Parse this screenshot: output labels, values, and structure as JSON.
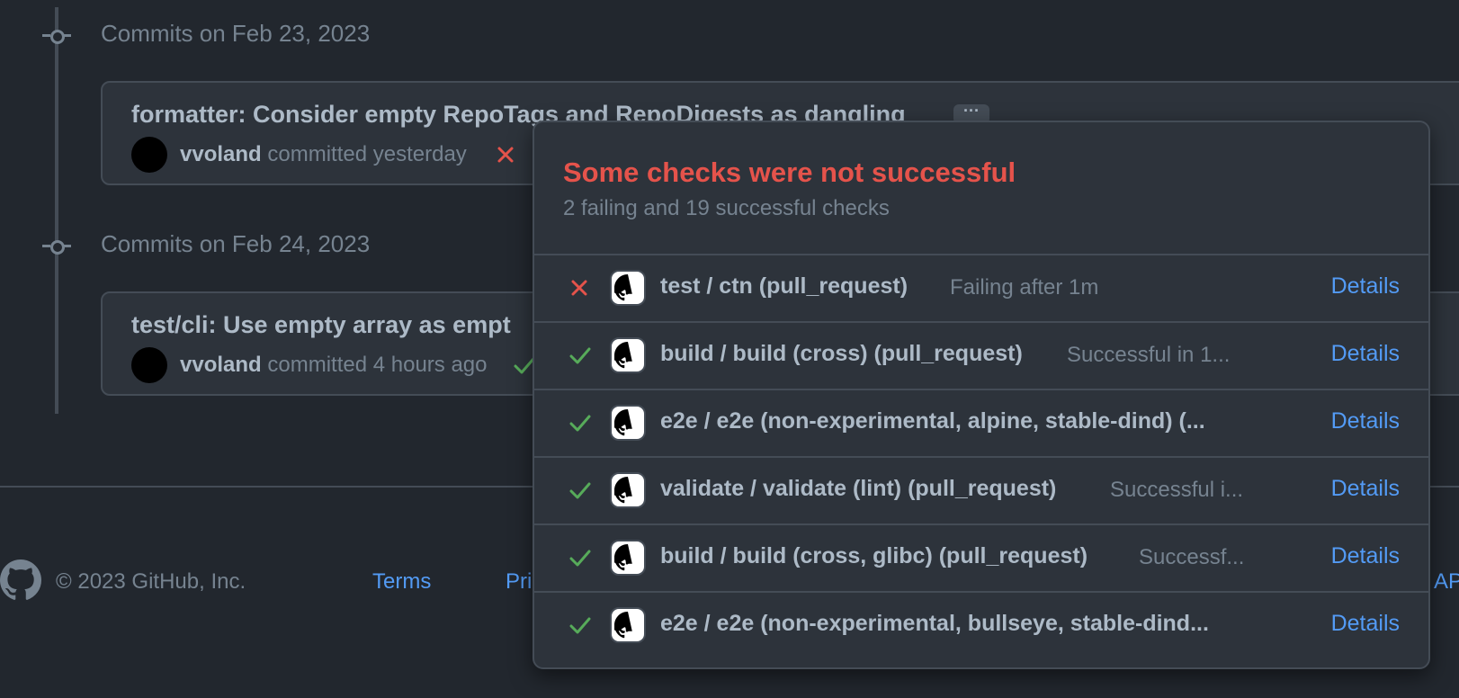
{
  "timeline": {
    "groups": [
      {
        "date_label": "Commits on Feb 23, 2023",
        "commit": {
          "title": "formatter: Consider empty RepoTags and RepoDigests as dangling",
          "ellipsis": "···",
          "author": "vvoland",
          "verb": "committed yesterday",
          "status": "failure"
        }
      },
      {
        "date_label": "Commits on Feb 24, 2023",
        "commit": {
          "title": "test/cli: Use empty array as empt",
          "author": "vvoland",
          "verb": "committed 4 hours ago",
          "status": "success"
        }
      }
    ]
  },
  "footer": {
    "copyright": "© 2023 GitHub, Inc.",
    "links": [
      "Terms",
      "Pri",
      "AP"
    ],
    "logo_icon": "github-mark-icon"
  },
  "checks_popover": {
    "title": "Some checks were not successful",
    "subtitle": "2 failing and 19 successful checks",
    "items": [
      {
        "status": "failure",
        "name": "test / ctn (pull_request)",
        "description": "Failing after 1m",
        "action": "Details"
      },
      {
        "status": "success",
        "name": "build / build (cross) (pull_request)",
        "description": "Successful in 1...",
        "action": "Details"
      },
      {
        "status": "success",
        "name": "e2e / e2e (non-experimental, alpine, stable-dind) (...",
        "description": "",
        "action": "Details"
      },
      {
        "status": "success",
        "name": "validate / validate (lint) (pull_request)",
        "description": "Successful i...",
        "action": "Details"
      },
      {
        "status": "success",
        "name": "build / build (cross, glibc) (pull_request)",
        "description": "Successf...",
        "action": "Details"
      },
      {
        "status": "success",
        "name": "e2e / e2e (non-experimental, bullseye, stable-dind...",
        "description": "",
        "action": "Details"
      }
    ]
  },
  "colors": {
    "background": "#22272e",
    "surface": "#2d333b",
    "border": "#444c56",
    "text": "#adbac7",
    "muted": "#768390",
    "link": "#539bf5",
    "danger": "#e5534b",
    "success": "#57ab5a"
  }
}
